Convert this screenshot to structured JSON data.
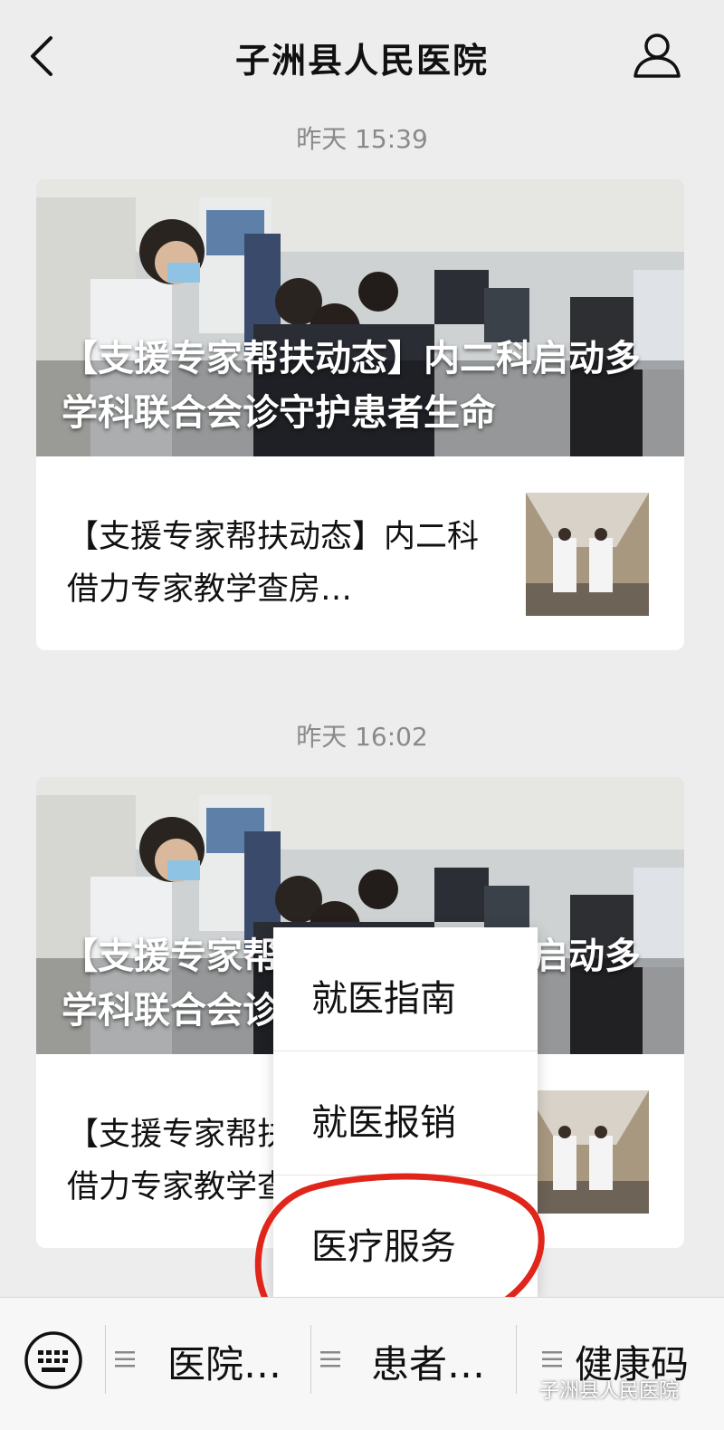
{
  "header": {
    "title": "子洲县人民医院"
  },
  "messages": [
    {
      "timestamp": "昨天 15:39",
      "cover_title": "【支援专家帮扶动态】内二科启动多学科联合会诊守护患者生命",
      "sub_title": "【支援专家帮扶动态】内二科借力专家教学查房…"
    },
    {
      "timestamp": "昨天 16:02",
      "cover_title": "【支援专家帮扶动态】内二科启动多学科联合会诊守护患者生命",
      "sub_title": "【支援专家帮扶动态】内二科借力专家教学查房…"
    }
  ],
  "popup_menu": {
    "items": [
      "就医指南",
      "就医报销",
      "医疗服务"
    ],
    "highlighted_index": 2,
    "highlight_color": "#e0261b"
  },
  "bottom_bar": {
    "tabs": [
      "医院…",
      "患者…",
      "健康码"
    ],
    "keyboard_icon": "keyboard-icon",
    "menu_icon": "menu-lines-icon"
  },
  "watermark": "子洲县人民医院"
}
